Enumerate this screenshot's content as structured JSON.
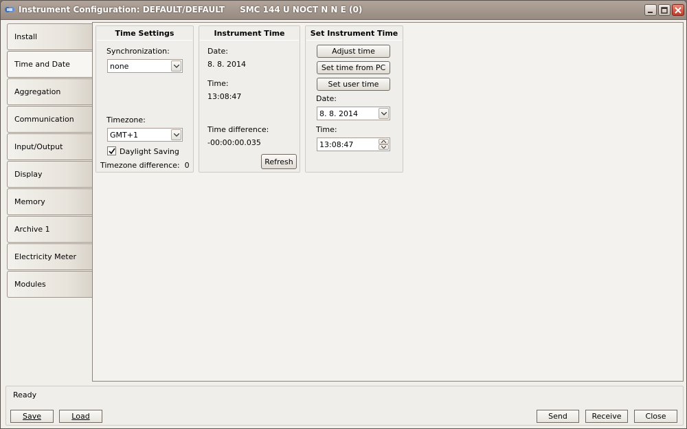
{
  "window": {
    "title": "Instrument Configuration: DEFAULT/DEFAULT",
    "subtitle": "SMC 144 U NOCT N N E (0)"
  },
  "tabs": [
    {
      "label": "Install"
    },
    {
      "label": "Time and Date",
      "active": true
    },
    {
      "label": "Aggregation"
    },
    {
      "label": "Communication"
    },
    {
      "label": "Input/Output"
    },
    {
      "label": "Display"
    },
    {
      "label": "Memory"
    },
    {
      "label": "Archive 1"
    },
    {
      "label": "Electricity Meter"
    },
    {
      "label": "Modules"
    }
  ],
  "time_settings": {
    "title": "Time Settings",
    "sync_label": "Synchronization:",
    "sync_value": "none",
    "timezone_label": "Timezone:",
    "timezone_value": "GMT+1",
    "daylight_label": "Daylight Saving",
    "daylight_checked": true,
    "tz_diff_label": "Timezone difference:",
    "tz_diff_value": "0"
  },
  "instrument_time": {
    "title": "Instrument Time",
    "date_label": "Date:",
    "date_value": "8. 8. 2014",
    "time_label": "Time:",
    "time_value": "13:08:47",
    "diff_label": "Time difference:",
    "diff_value": "-00:00:00.035",
    "refresh_label": "Refresh"
  },
  "set_time": {
    "title": "Set Instrument Time",
    "adjust_label": "Adjust time",
    "from_pc_label": "Set time from PC",
    "user_time_label": "Set user time",
    "date_label": "Date:",
    "date_value": "8. 8. 2014",
    "time_label": "Time:",
    "time_value": "13:08:47"
  },
  "status": {
    "text": "Ready"
  },
  "footer": {
    "save_label": "Save",
    "load_label": "Load",
    "send_label": "Send",
    "receive_label": "Receive",
    "close_label": "Close"
  },
  "icons": {
    "minimize": "minimize-icon",
    "maximize": "maximize-icon",
    "close": "close-icon",
    "dropdown": "chevron-down-icon",
    "check": "checkmark-icon"
  }
}
